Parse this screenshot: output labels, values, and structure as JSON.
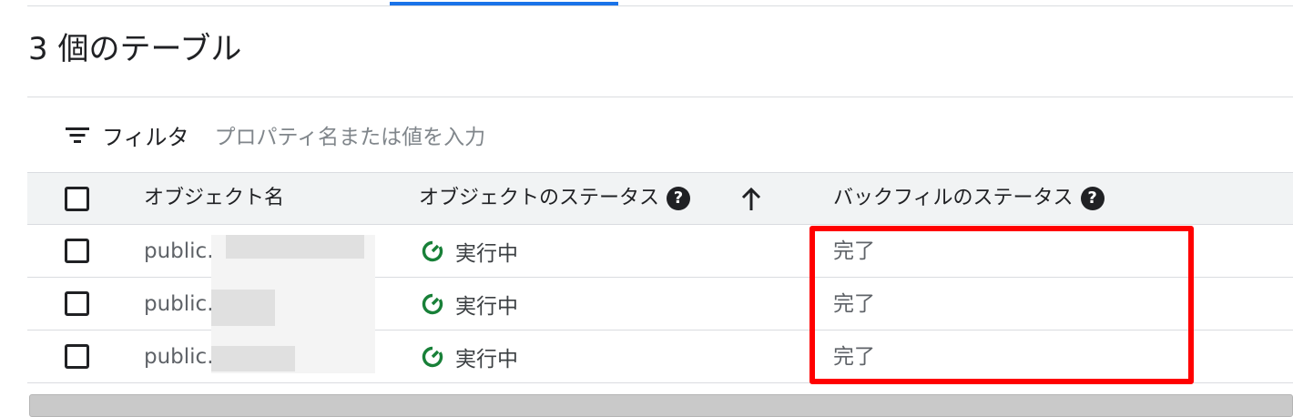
{
  "header": {
    "title": "3 個のテーブル"
  },
  "filter": {
    "label": "フィルタ",
    "placeholder": "プロパティ名または値を入力",
    "icon": "filter-list-icon"
  },
  "table": {
    "columns": {
      "object_name": "オブジェクト名",
      "object_status": "オブジェクトのステータス",
      "backfill_status": "バックフィルのステータス"
    },
    "help_glyph": "?",
    "sort": {
      "column": "object_status",
      "direction": "ascending",
      "icon": "arrow-upward-icon"
    },
    "rows": [
      {
        "name": "public.",
        "object_status": "実行中",
        "backfill_status": "完了"
      },
      {
        "name": "public.",
        "object_status": "実行中",
        "backfill_status": "完了"
      },
      {
        "name": "public.",
        "object_status": "実行中",
        "backfill_status": "完了"
      }
    ]
  },
  "colors": {
    "accent": "#1a73e8",
    "running_green": "#188038",
    "highlight_red": "#ff0000"
  }
}
